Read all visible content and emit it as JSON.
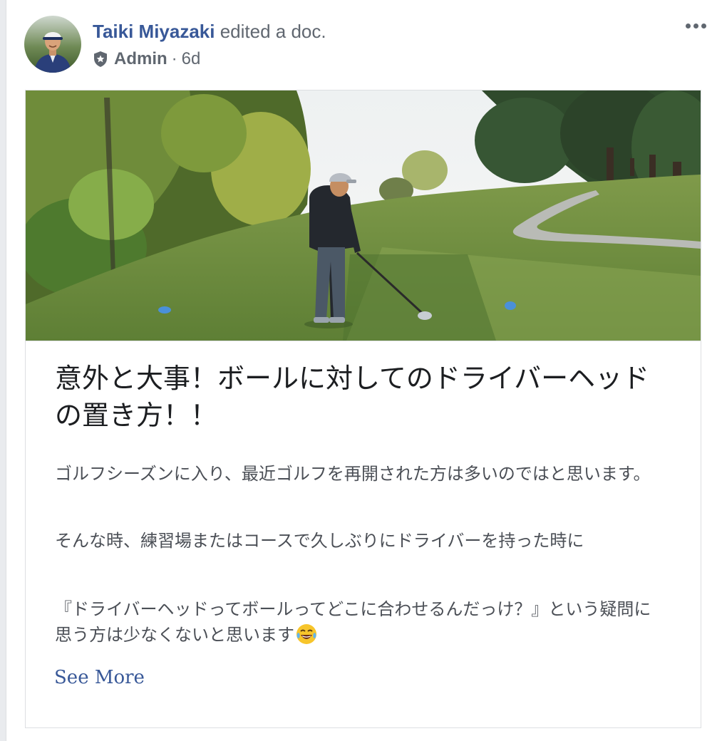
{
  "post": {
    "author_name": "Taiki Miyazaki",
    "action_text": " edited a doc.",
    "role": "Admin",
    "separator": "·",
    "time": "6d"
  },
  "doc": {
    "title": "意外と大事！ボールに対してのドライバーヘッドの置き方！！",
    "paragraphs": [
      "ゴルフシーズンに入り、最近ゴルフを再開された方は多いのではと思います。",
      "そんな時、練習場またはコースで久しぶりにドライバーを持った時に",
      "『ドライバーヘッドってボールってどこに合わせるんだっけ？』という疑問に思う方は少なくないと思います"
    ],
    "see_more": "See More"
  },
  "icons": {
    "admin": "shield-icon",
    "more": "more-options-icon",
    "emoji": "laughing-tears-emoji"
  },
  "colors": {
    "link": "#385898",
    "meta": "#606770",
    "title": "#1c1e21",
    "body": "#4b4f56",
    "border": "#dddfe2"
  }
}
